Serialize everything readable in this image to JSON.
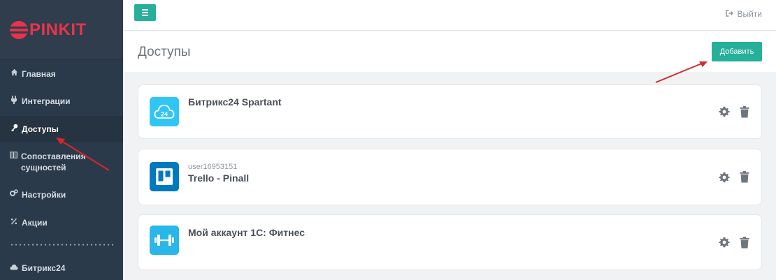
{
  "brand": {
    "logo_text": "PINKIT"
  },
  "sidebar": {
    "items": [
      {
        "label": "Главная",
        "icon": "home-icon"
      },
      {
        "label": "Интеграции",
        "icon": "plug-icon"
      },
      {
        "label": "Доступы",
        "icon": "key-icon",
        "active": true
      },
      {
        "label": "Сопоставления сущностей",
        "icon": "table-icon"
      },
      {
        "label": "Настройки",
        "icon": "gears-icon"
      },
      {
        "label": "Акции",
        "icon": "percent-icon"
      },
      {
        "label": "Битрикс24",
        "icon": "cloud-icon"
      }
    ]
  },
  "topbar": {
    "logout_label": "Выйти"
  },
  "page": {
    "title": "Доступы",
    "add_label": "Добавить"
  },
  "accesses": [
    {
      "subtitle": "",
      "title": "Битрикс24 Spartant",
      "icon": "bitrix24-cloud-icon",
      "icon_color": "#2fc6f6",
      "icon_text": "24"
    },
    {
      "subtitle": "user16953151",
      "title": "Trello - Pinall",
      "icon": "trello-icon",
      "icon_color": "#0079bf"
    },
    {
      "subtitle": "",
      "title": "Мой аккаунт 1С: Фитнес",
      "icon": "dumbbell-icon",
      "icon_color": "#29b6e8"
    }
  ],
  "colors": {
    "sidebar": "#2b3a4a",
    "accent": "#26b09a",
    "brand_red": "#e8334b",
    "annotation_arrow": "#d62828"
  }
}
